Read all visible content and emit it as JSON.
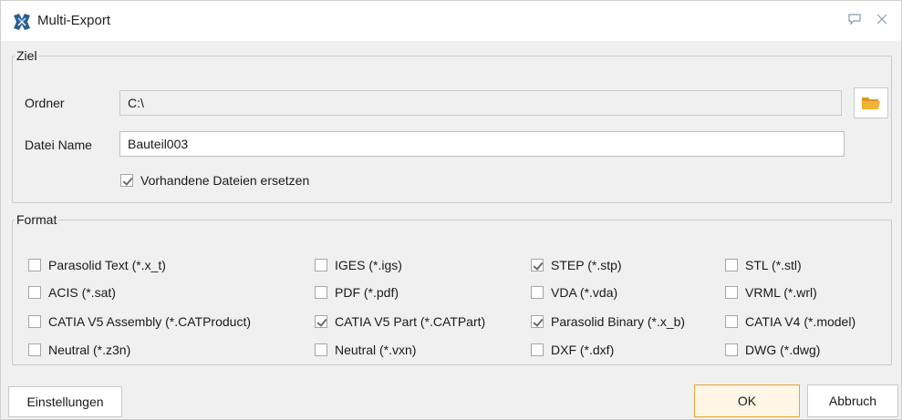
{
  "window": {
    "title": "Multi-Export"
  },
  "ziel": {
    "legend": "Ziel",
    "folder_label": "Ordner",
    "folder_value": "C:\\",
    "filename_label": "Datei Name",
    "filename_value": "Bauteil003",
    "overwrite_label": "Vorhandene Dateien ersetzen",
    "overwrite_checked": true
  },
  "format": {
    "legend": "Format",
    "options": [
      {
        "label": "Parasolid Text (*.x_t)",
        "checked": false
      },
      {
        "label": "IGES (*.igs)",
        "checked": false
      },
      {
        "label": "STEP (*.stp)",
        "checked": true
      },
      {
        "label": "STL (*.stl)",
        "checked": false
      },
      {
        "label": "ACIS (*.sat)",
        "checked": false
      },
      {
        "label": "PDF (*.pdf)",
        "checked": false
      },
      {
        "label": "VDA (*.vda)",
        "checked": false
      },
      {
        "label": "VRML (*.wrl)",
        "checked": false
      },
      {
        "label": "CATIA V5 Assembly (*.CATProduct)",
        "checked": false
      },
      {
        "label": "CATIA V5 Part (*.CATPart)",
        "checked": true
      },
      {
        "label": "Parasolid Binary (*.x_b)",
        "checked": true
      },
      {
        "label": "CATIA V4 (*.model)",
        "checked": false
      },
      {
        "label": "Neutral (*.z3n)",
        "checked": false
      },
      {
        "label": "Neutral (*.vxn)",
        "checked": false
      },
      {
        "label": "DXF (*.dxf)",
        "checked": false
      },
      {
        "label": "DWG (*.dwg)",
        "checked": false
      }
    ]
  },
  "buttons": {
    "settings": "Einstellungen",
    "ok": "OK",
    "cancel": "Abbruch"
  },
  "colors": {
    "accent_border": "#e8a33a",
    "folder_icon": "#f2b233"
  }
}
